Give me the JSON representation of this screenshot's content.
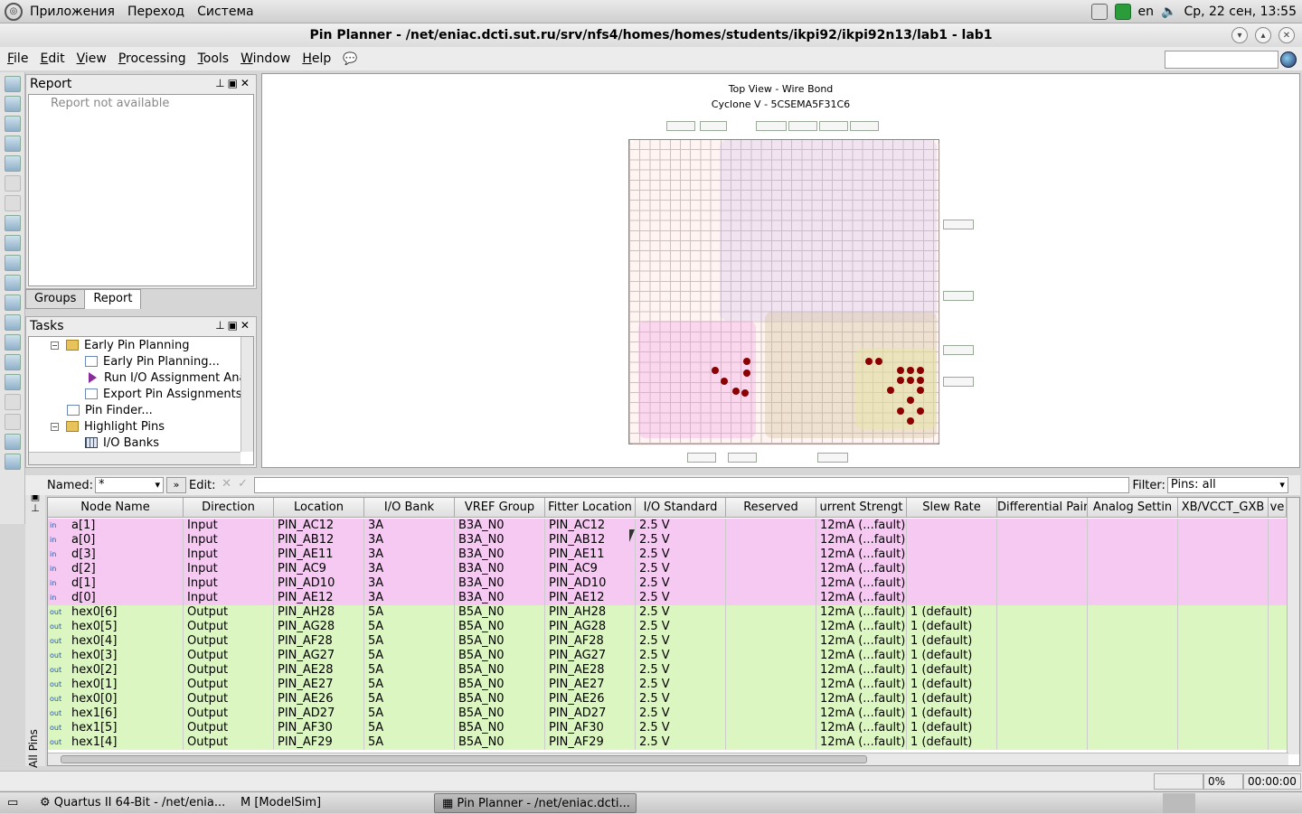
{
  "top_panel": {
    "menus": [
      "Приложения",
      "Переход",
      "Система"
    ],
    "lang": "en",
    "clock": "Ср, 22 сен, 13:55"
  },
  "window": {
    "title": "Pin Planner - /net/eniac.dcti.sut.ru/srv/nfs4/homes/homes/students/ikpi92/ikpi92n13/lab1 - lab1"
  },
  "menubar": [
    "File",
    "Edit",
    "View",
    "Processing",
    "Tools",
    "Window",
    "Help"
  ],
  "report_panel": {
    "title": "Report",
    "body": "Report not available"
  },
  "panel_tabs": [
    "Groups",
    "Report"
  ],
  "tasks_panel": {
    "title": "Tasks",
    "items": [
      {
        "label": "Early Pin Planning",
        "icon": "folder-icon",
        "level": 1,
        "toggle": "minus"
      },
      {
        "label": "Early Pin Planning...",
        "icon": "document-icon",
        "level": 2
      },
      {
        "label": "Run I/O Assignment Ana",
        "icon": "run-icon",
        "level": 2
      },
      {
        "label": "Export Pin Assignments",
        "icon": "document-icon",
        "level": 2
      },
      {
        "label": "Pin Finder...",
        "icon": "document-icon",
        "level": 1
      },
      {
        "label": "Highlight Pins",
        "icon": "folder-icon",
        "level": 1,
        "toggle": "minus"
      },
      {
        "label": "I/O Banks",
        "icon": "table-icon",
        "level": 2
      }
    ]
  },
  "package_view": {
    "title": "Top View - Wire Bond",
    "subtitle": "Cyclone V - 5CSEMA5F31C6"
  },
  "filter_bar": {
    "named_label": "Named:",
    "named_value": "*",
    "edit_label": "Edit:",
    "filter_label": "Filter:",
    "filter_value": "Pins: all"
  },
  "table": {
    "side_tab": "All Pins",
    "columns": [
      "Node Name",
      "Direction",
      "Location",
      "I/O Bank",
      "VREF Group",
      "Fitter Location",
      "I/O Standard",
      "Reserved",
      "urrent Strengt",
      "Slew Rate",
      "Differential Pair",
      "Analog Settin",
      "XB/VCCT_GXB",
      "ve"
    ],
    "rows": [
      {
        "name": "a[1]",
        "dir_tag": "in",
        "direction": "Input",
        "location": "PIN_AC12",
        "bank": "3A",
        "vref": "B3A_N0",
        "fitter": "PIN_AC12",
        "standard": "2.5 V",
        "reserved": "",
        "current": "12mA (...fault)",
        "slew": ""
      },
      {
        "name": "a[0]",
        "dir_tag": "in",
        "direction": "Input",
        "location": "PIN_AB12",
        "bank": "3A",
        "vref": "B3A_N0",
        "fitter": "PIN_AB12",
        "standard": "2.5 V",
        "reserved": "",
        "current": "12mA (...fault)",
        "slew": ""
      },
      {
        "name": "d[3]",
        "dir_tag": "in",
        "direction": "Input",
        "location": "PIN_AE11",
        "bank": "3A",
        "vref": "B3A_N0",
        "fitter": "PIN_AE11",
        "standard": "2.5 V",
        "reserved": "",
        "current": "12mA (...fault)",
        "slew": ""
      },
      {
        "name": "d[2]",
        "dir_tag": "in",
        "direction": "Input",
        "location": "PIN_AC9",
        "bank": "3A",
        "vref": "B3A_N0",
        "fitter": "PIN_AC9",
        "standard": "2.5 V",
        "reserved": "",
        "current": "12mA (...fault)",
        "slew": ""
      },
      {
        "name": "d[1]",
        "dir_tag": "in",
        "direction": "Input",
        "location": "PIN_AD10",
        "bank": "3A",
        "vref": "B3A_N0",
        "fitter": "PIN_AD10",
        "standard": "2.5 V",
        "reserved": "",
        "current": "12mA (...fault)",
        "slew": ""
      },
      {
        "name": "d[0]",
        "dir_tag": "in",
        "direction": "Input",
        "location": "PIN_AE12",
        "bank": "3A",
        "vref": "B3A_N0",
        "fitter": "PIN_AE12",
        "standard": "2.5 V",
        "reserved": "",
        "current": "12mA (...fault)",
        "slew": ""
      },
      {
        "name": "hex0[6]",
        "dir_tag": "out",
        "direction": "Output",
        "location": "PIN_AH28",
        "bank": "5A",
        "vref": "B5A_N0",
        "fitter": "PIN_AH28",
        "standard": "2.5 V",
        "reserved": "",
        "current": "12mA (...fault)",
        "slew": "1 (default)"
      },
      {
        "name": "hex0[5]",
        "dir_tag": "out",
        "direction": "Output",
        "location": "PIN_AG28",
        "bank": "5A",
        "vref": "B5A_N0",
        "fitter": "PIN_AG28",
        "standard": "2.5 V",
        "reserved": "",
        "current": "12mA (...fault)",
        "slew": "1 (default)"
      },
      {
        "name": "hex0[4]",
        "dir_tag": "out",
        "direction": "Output",
        "location": "PIN_AF28",
        "bank": "5A",
        "vref": "B5A_N0",
        "fitter": "PIN_AF28",
        "standard": "2.5 V",
        "reserved": "",
        "current": "12mA (...fault)",
        "slew": "1 (default)"
      },
      {
        "name": "hex0[3]",
        "dir_tag": "out",
        "direction": "Output",
        "location": "PIN_AG27",
        "bank": "5A",
        "vref": "B5A_N0",
        "fitter": "PIN_AG27",
        "standard": "2.5 V",
        "reserved": "",
        "current": "12mA (...fault)",
        "slew": "1 (default)"
      },
      {
        "name": "hex0[2]",
        "dir_tag": "out",
        "direction": "Output",
        "location": "PIN_AE28",
        "bank": "5A",
        "vref": "B5A_N0",
        "fitter": "PIN_AE28",
        "standard": "2.5 V",
        "reserved": "",
        "current": "12mA (...fault)",
        "slew": "1 (default)"
      },
      {
        "name": "hex0[1]",
        "dir_tag": "out",
        "direction": "Output",
        "location": "PIN_AE27",
        "bank": "5A",
        "vref": "B5A_N0",
        "fitter": "PIN_AE27",
        "standard": "2.5 V",
        "reserved": "",
        "current": "12mA (...fault)",
        "slew": "1 (default)"
      },
      {
        "name": "hex0[0]",
        "dir_tag": "out",
        "direction": "Output",
        "location": "PIN_AE26",
        "bank": "5A",
        "vref": "B5A_N0",
        "fitter": "PIN_AE26",
        "standard": "2.5 V",
        "reserved": "",
        "current": "12mA (...fault)",
        "slew": "1 (default)"
      },
      {
        "name": "hex1[6]",
        "dir_tag": "out",
        "direction": "Output",
        "location": "PIN_AD27",
        "bank": "5A",
        "vref": "B5A_N0",
        "fitter": "PIN_AD27",
        "standard": "2.5 V",
        "reserved": "",
        "current": "12mA (...fault)",
        "slew": "1 (default)"
      },
      {
        "name": "hex1[5]",
        "dir_tag": "out",
        "direction": "Output",
        "location": "PIN_AF30",
        "bank": "5A",
        "vref": "B5A_N0",
        "fitter": "PIN_AF30",
        "standard": "2.5 V",
        "reserved": "",
        "current": "12mA (...fault)",
        "slew": "1 (default)"
      },
      {
        "name": "hex1[4]",
        "dir_tag": "out",
        "direction": "Output",
        "location": "PIN_AF29",
        "bank": "5A",
        "vref": "B5A_N0",
        "fitter": "PIN_AF29",
        "standard": "2.5 V",
        "reserved": "",
        "current": "12mA (...fault)",
        "slew": "1 (default)"
      }
    ]
  },
  "statusbar": {
    "progress": "0%",
    "time": "00:00:00"
  },
  "taskbar": {
    "items": [
      "Quartus II 64-Bit - /net/enia...",
      "[ModelSim]",
      "Pin Planner - /net/eniac.dcti..."
    ]
  },
  "colors": {
    "input_row": "#f6c9f3",
    "output_row": "#dcf6c2"
  }
}
